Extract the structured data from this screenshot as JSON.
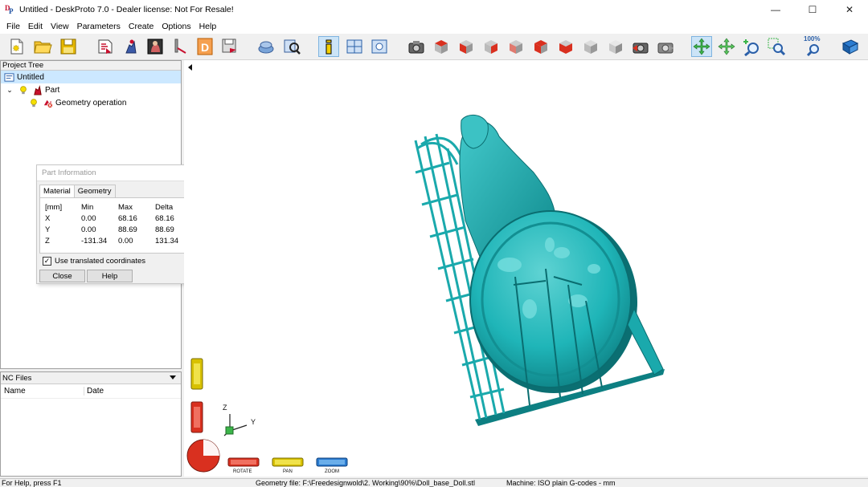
{
  "window": {
    "title": "Untitled - DeskProto 7.0 - Dealer license: Not For Resale!",
    "minimize": "—",
    "maximize": "☐",
    "close": "✕"
  },
  "menu": [
    "File",
    "Edit",
    "View",
    "Parameters",
    "Create",
    "Options",
    "Help"
  ],
  "toolbar": {
    "zoom_label": "100%"
  },
  "project_tree": {
    "header": "Project Tree",
    "root": "Untitled",
    "part": "Part",
    "operation": "Geometry operation"
  },
  "part_info": {
    "title": "Part Information",
    "tabs": [
      "Material",
      "Geometry"
    ],
    "columns": [
      "[mm]",
      "Min",
      "Max",
      "Delta"
    ],
    "rows": [
      [
        "X",
        "0.00",
        "68.16",
        "68.16"
      ],
      [
        "Y",
        "0.00",
        "88.69",
        "88.69"
      ],
      [
        "Z",
        "-131.34",
        "0.00",
        "131.34"
      ]
    ],
    "checkbox_label": "Use translated coordinates",
    "checkbox_checked": "✓",
    "close_button": "Close",
    "help_button": "Help"
  },
  "nc_files": {
    "header": "NC Files",
    "columns": [
      "Name",
      "Date"
    ]
  },
  "viewport": {
    "axis_z": "Z",
    "axis_y": "Y",
    "rotate_label": "ROTATE",
    "pan_label": "PAN",
    "zoom_label": "ZOOM"
  },
  "status": {
    "help": "For Help, press F1",
    "geometry_file": "Geometry file: F:\\Freedesignwold\\2. Working\\90%\\Doll_base_Doll.stl",
    "machine": "Machine: ISO plain G-codes - mm"
  },
  "colors": {
    "model": "#1fb5b8",
    "model_dark": "#0d7f82",
    "selection": "#cce8ff",
    "rotate": "#d9301f",
    "pan": "#d8c100",
    "zoom": "#2a7bd0"
  }
}
